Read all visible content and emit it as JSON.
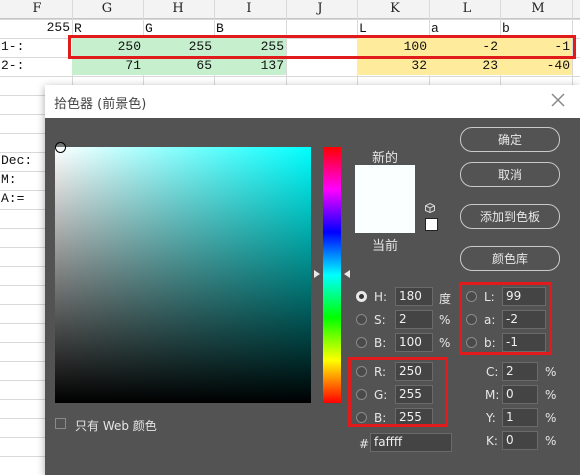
{
  "sheet": {
    "columns": [
      "F",
      "G",
      "H",
      "I",
      "J",
      "K",
      "L",
      "M"
    ],
    "top_cells": {
      "f": "255",
      "g": "R",
      "h": "G",
      "i": "B",
      "k": "L",
      "l": "a",
      "m": "b"
    },
    "rows": [
      {
        "label": "1-:",
        "g": "250",
        "h": "255",
        "i": "255",
        "k": "100",
        "l": "-2",
        "m": "-1"
      },
      {
        "label": "2-:",
        "g": "71",
        "h": "65",
        "i": "137",
        "k": "32",
        "l": "23",
        "m": "-40"
      }
    ],
    "side_labels": [
      "Dec:",
      "M:",
      "A:="
    ],
    "highlight_color_green": "#c6efce",
    "highlight_color_yellow": "#ffeb9c"
  },
  "dialog": {
    "title": "拾色器 (前景色)",
    "new_label": "新的",
    "current_label": "当前",
    "buttons": {
      "ok": "确定",
      "cancel": "取消",
      "add_swatch": "添加到色板",
      "library": "颜色库"
    },
    "hsb": [
      {
        "label": "H:",
        "value": "180",
        "unit": "度",
        "selected": true
      },
      {
        "label": "S:",
        "value": "2",
        "unit": "%",
        "selected": false
      },
      {
        "label": "B:",
        "value": "100",
        "unit": "%",
        "selected": false
      }
    ],
    "rgb": [
      {
        "label": "R:",
        "value": "250"
      },
      {
        "label": "G:",
        "value": "255"
      },
      {
        "label": "B:",
        "value": "255"
      }
    ],
    "lab": [
      {
        "label": "L:",
        "value": "99"
      },
      {
        "label": "a:",
        "value": "-2"
      },
      {
        "label": "b:",
        "value": "-1"
      }
    ],
    "cmyk": [
      {
        "label": "C:",
        "value": "2",
        "unit": "%"
      },
      {
        "label": "M:",
        "value": "0",
        "unit": "%"
      },
      {
        "label": "Y:",
        "value": "1",
        "unit": "%"
      },
      {
        "label": "K:",
        "value": "0",
        "unit": "%"
      }
    ],
    "hex_label": "#",
    "hex": "faffff",
    "web_only": "只有 Web 颜色",
    "new_color": "#faffff",
    "annotation_color": "#e11b1b"
  }
}
